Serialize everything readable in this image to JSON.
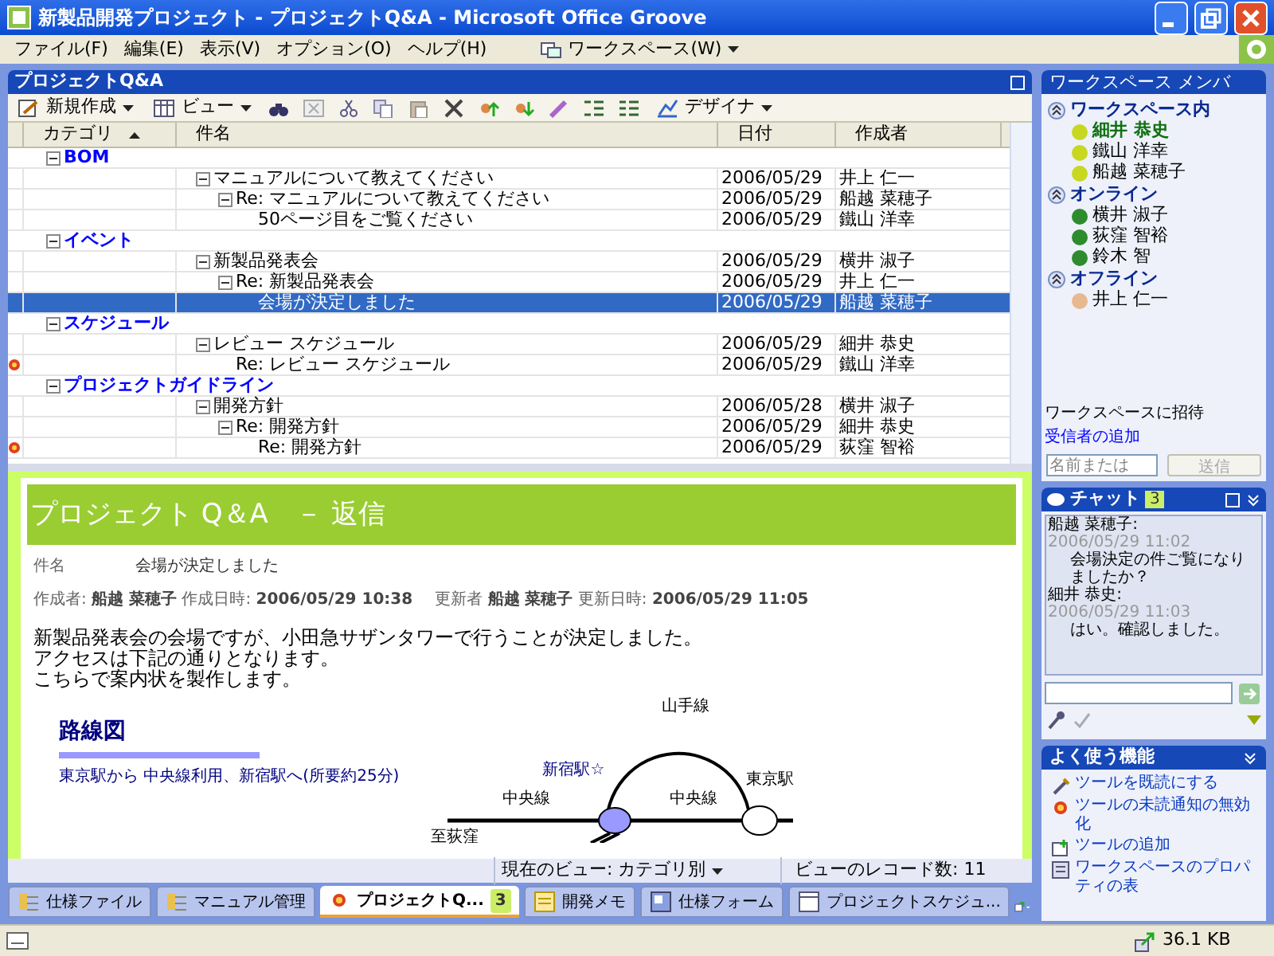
{
  "window": {
    "title": "新製品開発プロジェクト - プロジェクトQ&A - Microsoft Office Groove"
  },
  "menu_bar": {
    "items": [
      "ファイル(F)",
      "編集(E)",
      "表示(V)",
      "オプション(O)",
      "ヘルプ(H)"
    ],
    "workspace_menu": "ワークスペース(W)"
  },
  "tool_panel": {
    "title": "プロジェクトQ&A",
    "toolbar": [
      {
        "kind": "menu",
        "label": "新規作成"
      },
      {
        "kind": "menu",
        "label": "ビュー"
      },
      {
        "kind": "icons"
      },
      {
        "kind": "menu",
        "label": "デザイナ"
      }
    ],
    "columns": [
      "カテゴリ",
      "件名",
      "日付",
      "作成者"
    ],
    "categories": [
      {
        "label": "BOM",
        "expanded": true,
        "children": [
          {
            "subject": "マニュアルについて教えてください",
            "date": "2006/05/29",
            "author": "井上 仁一",
            "selected": false,
            "unread": false,
            "expanded": true,
            "children": [
              {
                "subject": "Re: マニュアルについて教えてください",
                "date": "2006/05/29",
                "author": "船越 菜穂子",
                "selected": false,
                "unread": false,
                "expanded": true,
                "children": [
                  {
                    "subject": "50ページ目をご覧ください",
                    "date": "2006/05/29",
                    "author": "鐵山 洋幸",
                    "selected": false,
                    "unread": false
                  }
                ]
              }
            ]
          }
        ]
      },
      {
        "label": "イベント",
        "expanded": true,
        "children": [
          {
            "subject": "新製品発表会",
            "date": "2006/05/29",
            "author": "横井 淑子",
            "selected": false,
            "unread": false,
            "expanded": true,
            "children": [
              {
                "subject": "Re: 新製品発表会",
                "date": "2006/05/29",
                "author": "井上 仁一",
                "selected": false,
                "unread": false,
                "expanded": true,
                "children": [
                  {
                    "subject": "会場が決定しました",
                    "date": "2006/05/29",
                    "author": "船越 菜穂子",
                    "selected": true,
                    "unread": false
                  }
                ]
              }
            ]
          }
        ]
      },
      {
        "label": "スケジュール",
        "expanded": true,
        "children": [
          {
            "subject": "レビュー スケジュール",
            "date": "2006/05/29",
            "author": "細井 恭史",
            "selected": false,
            "unread": false,
            "expanded": true,
            "children": [
              {
                "subject": "Re: レビュー スケジュール",
                "date": "2006/05/29",
                "author": "鐵山 洋幸",
                "selected": false,
                "unread": true
              }
            ]
          }
        ]
      },
      {
        "label": "プロジェクトガイドライン",
        "expanded": true,
        "children": [
          {
            "subject": "開発方針",
            "date": "2006/05/28",
            "author": "横井 淑子",
            "selected": false,
            "unread": false,
            "expanded": true,
            "children": [
              {
                "subject": "Re: 開発方針",
                "date": "2006/05/29",
                "author": "細井 恭史",
                "selected": false,
                "unread": false,
                "expanded": true,
                "children": [
                  {
                    "subject": "Re: 開発方針",
                    "date": "2006/05/29",
                    "author": "荻窪 智裕",
                    "selected": false,
                    "unread": true
                  }
                ]
              }
            ]
          }
        ]
      }
    ]
  },
  "preview": {
    "header": "プロジェクト Q＆A　－ 返信",
    "subject_label": "件名",
    "subject": "会場が決定しました",
    "meta": [
      "作成者: **船越 菜穂子** 作成日時: **2006/05/29 10:38**",
      "更新者 **船越 菜穂子** 更新日時: **2006/05/29 11:05**"
    ],
    "body": [
      "新製品発表会の会場ですが、小田急サザンタワーで行うことが決定しました。",
      "アクセスは下記の通りとなります。",
      "こちらで案内状を製作します。"
    ],
    "map": {
      "title": "路線図",
      "caption": "東京駅から 中央線利用、新宿駅へ(所要約25分)",
      "labels": [
        "山手線",
        "新宿駅☆",
        "東京駅",
        "中央線",
        "中央線",
        "至荻窪"
      ]
    }
  },
  "view_bar": {
    "current_view": "現在のビュー: カテゴリ別",
    "record_count": "ビューのレコード数: 11"
  },
  "tool_tabs": [
    {
      "label": "仕様ファイル",
      "selected": false
    },
    {
      "label": "マニュアル管理",
      "selected": false
    },
    {
      "label": "プロジェクトQ...",
      "selected": true,
      "badge": "3"
    },
    {
      "label": "開発メモ",
      "selected": false
    },
    {
      "label": "仕様フォーム",
      "selected": false
    },
    {
      "label": "プロジェクトスケジュ...",
      "selected": false
    }
  ],
  "members": {
    "title": "ワークスペース メンバ",
    "groups": [
      {
        "label": "ワークスペース内",
        "expanded": true,
        "members": [
          {
            "name": "細井 恭史",
            "color": "#c8d820",
            "me": true
          },
          {
            "name": "鐵山 洋幸",
            "color": "#c8d820",
            "me": false
          },
          {
            "name": "船越 菜穂子",
            "color": "#c8d820",
            "me": false
          }
        ]
      },
      {
        "label": "オンライン",
        "expanded": true,
        "members": [
          {
            "name": "横井 淑子",
            "color": "#2e8b2e",
            "me": false
          },
          {
            "name": "荻窪 智裕",
            "color": "#2e8b2e",
            "me": false
          },
          {
            "name": "鈴木 智",
            "color": "#2e8b2e",
            "me": false
          }
        ]
      },
      {
        "label": "オフライン",
        "expanded": true,
        "members": [
          {
            "name": "井上 仁一",
            "color": "#e8b890",
            "me": false
          }
        ]
      }
    ],
    "invite_label": "ワークスペースに招待",
    "invite_link": "受信者の追加",
    "invite_placeholder": "名前または",
    "send_button": "送信",
    "send_disabled": true
  },
  "chat": {
    "title": "チャット",
    "badge": "3",
    "messages": [
      {
        "author": "船越 菜穂子:",
        "time": "2006/05/29 11:02",
        "text": "会場決定の件ご覧になりましたか？"
      },
      {
        "author": "細井 恭史:",
        "time": "2006/05/29 11:03",
        "text": "はい。確認しました。"
      }
    ]
  },
  "common_tasks": {
    "title": "よく使う機能",
    "items": [
      "ツールを既読にする",
      "ツールの未読通知の無効化",
      "ツールの追加",
      "ワークスペースのプロパティの表"
    ]
  },
  "status_bar": {
    "size": "36.1 KB"
  }
}
